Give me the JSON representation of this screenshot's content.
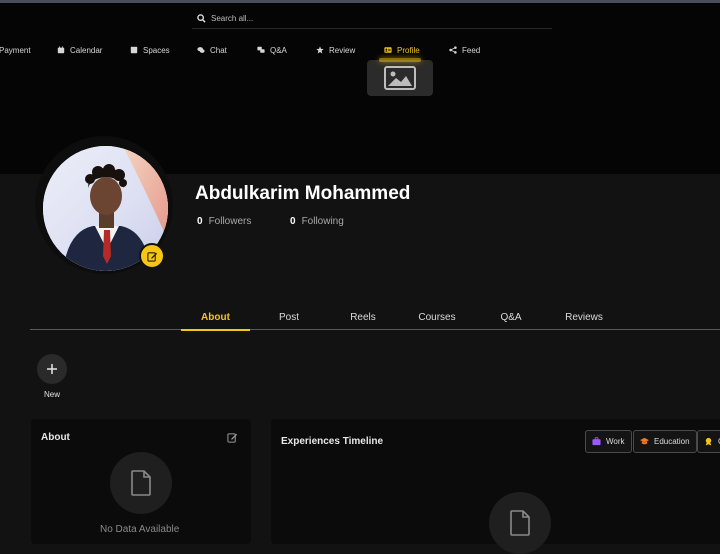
{
  "search": {
    "placeholder": "Search all..."
  },
  "nav": {
    "items": [
      {
        "label": "Payment",
        "icon": "payment-icon"
      },
      {
        "label": "Calendar",
        "icon": "calendar-icon"
      },
      {
        "label": "Spaces",
        "icon": "spaces-icon"
      },
      {
        "label": "Chat",
        "icon": "chat-icon"
      },
      {
        "label": "Q&A",
        "icon": "qa-icon"
      },
      {
        "label": "Review",
        "icon": "star-icon"
      },
      {
        "label": "Profile",
        "icon": "id-card-icon",
        "active": true
      },
      {
        "label": "Feed",
        "icon": "share-icon"
      }
    ]
  },
  "profile": {
    "name": "Abdulkarim Mohammed",
    "followers_count": "0",
    "followers_label": "Followers",
    "following_count": "0",
    "following_label": "Following"
  },
  "tabs": [
    {
      "label": "About",
      "active": true
    },
    {
      "label": "Post"
    },
    {
      "label": "Reels"
    },
    {
      "label": "Courses"
    },
    {
      "label": "Q&A"
    },
    {
      "label": "Reviews"
    }
  ],
  "new_button": {
    "label": "New"
  },
  "about_card": {
    "title": "About",
    "empty_text": "No Data Available"
  },
  "experience_card": {
    "title": "Experiences Timeline",
    "filters": [
      {
        "label": "Work",
        "color": "#9b59f5"
      },
      {
        "label": "Education",
        "color": "#f07a2a"
      },
      {
        "label": "C",
        "color": "#f5c518"
      }
    ]
  },
  "colors": {
    "accent": "#f5c518",
    "background": "#121212",
    "card": "#0b0b0b"
  }
}
